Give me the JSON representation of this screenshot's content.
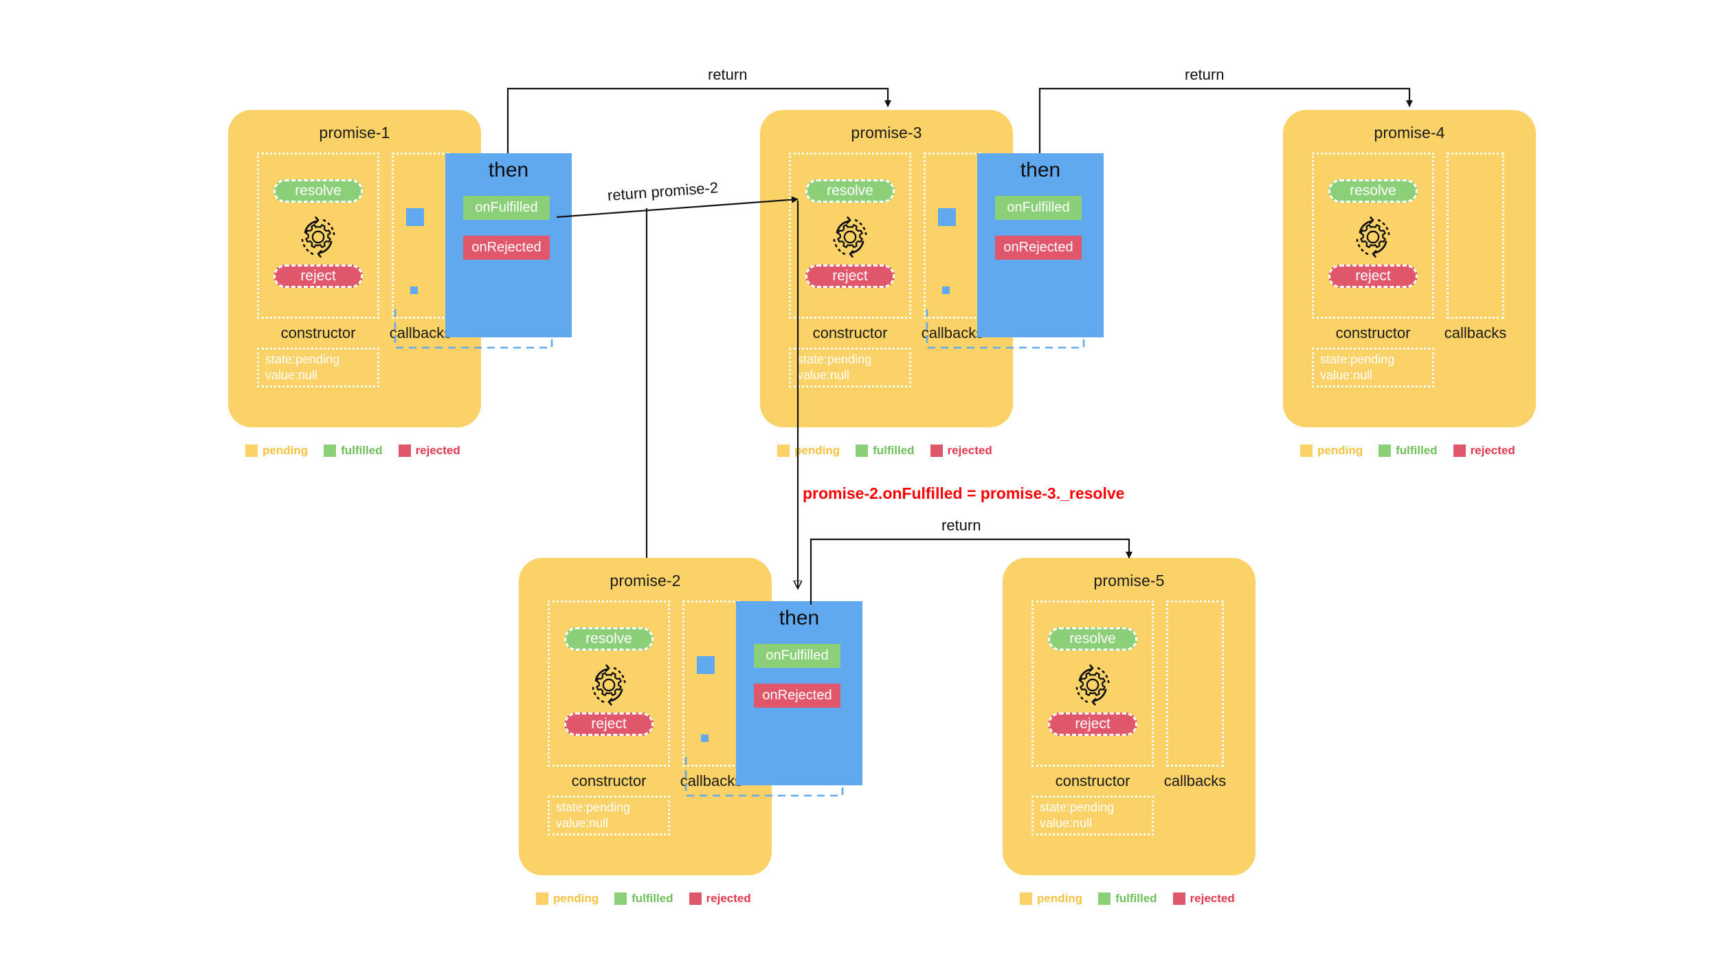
{
  "diagram": {
    "title": "Promise chaining diagram",
    "colors": {
      "pending": "#fbd268",
      "fulfilled": "#8bd079",
      "rejected": "#e0576b",
      "then": "#60a9ef",
      "note": "#fe0000",
      "background": "#ffffff"
    }
  },
  "labels": {
    "constructor": "constructor",
    "callbacks": "callbacks",
    "resolve": "resolve",
    "reject": "reject",
    "then": "then",
    "on_fulfilled": "onFulfilled",
    "on_rejected": "onRejected",
    "state": "state:pending",
    "value": "value:null"
  },
  "legend": {
    "pending": "pending",
    "fulfilled": "fulfilled",
    "rejected": "rejected"
  },
  "promises": [
    {
      "id": "promise-1",
      "name": "promise-1",
      "has_then": true,
      "state": "state:pending",
      "value": "value:null"
    },
    {
      "id": "promise-3",
      "name": "promise-3",
      "has_then": true,
      "state": "state:pending",
      "value": "value:null"
    },
    {
      "id": "promise-4",
      "name": "promise-4",
      "has_then": false,
      "state": "state:pending",
      "value": "value:null"
    },
    {
      "id": "promise-2",
      "name": "promise-2",
      "has_then": true,
      "state": "state:pending",
      "value": "value:null"
    },
    {
      "id": "promise-5",
      "name": "promise-5",
      "has_then": false,
      "state": "state:pending",
      "value": "value:null"
    }
  ],
  "connections": {
    "return_1": "return",
    "return_2": "return",
    "return_3": "return",
    "return_promise_2": "return promise-2"
  },
  "annotation": {
    "assignment": "promise-2.onFulfilled = promise-3._resolve"
  }
}
